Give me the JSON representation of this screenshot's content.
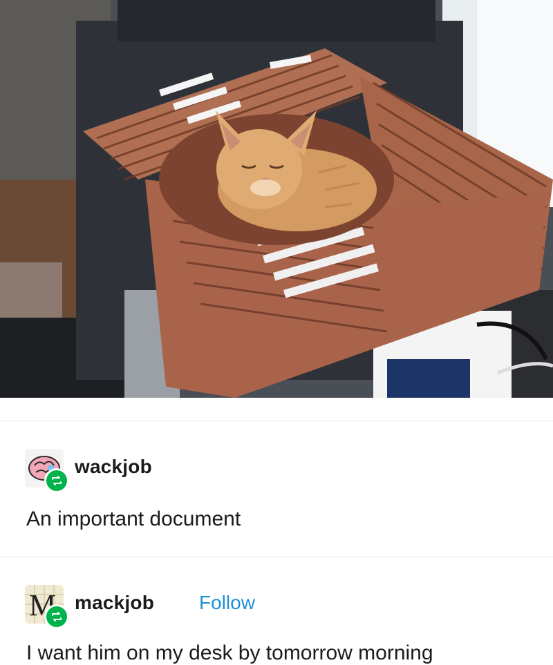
{
  "post_image": {
    "subject": "photo-of-kitten-in-accordion-file"
  },
  "reblogs": [
    {
      "username": "wackjob",
      "avatar": "brain-avatar",
      "badge_icon": "reblog-icon",
      "text": "An important document"
    },
    {
      "username": "mackjob",
      "avatar": "letter-m-avatar",
      "avatar_letter": "M",
      "badge_icon": "reblog-icon",
      "follow_label": "Follow",
      "text": "I want him on my desk by tomorrow morning"
    }
  ],
  "colors": {
    "follow": "#1e90d6",
    "badge": "#00b34a",
    "folder": "#a8654a"
  }
}
